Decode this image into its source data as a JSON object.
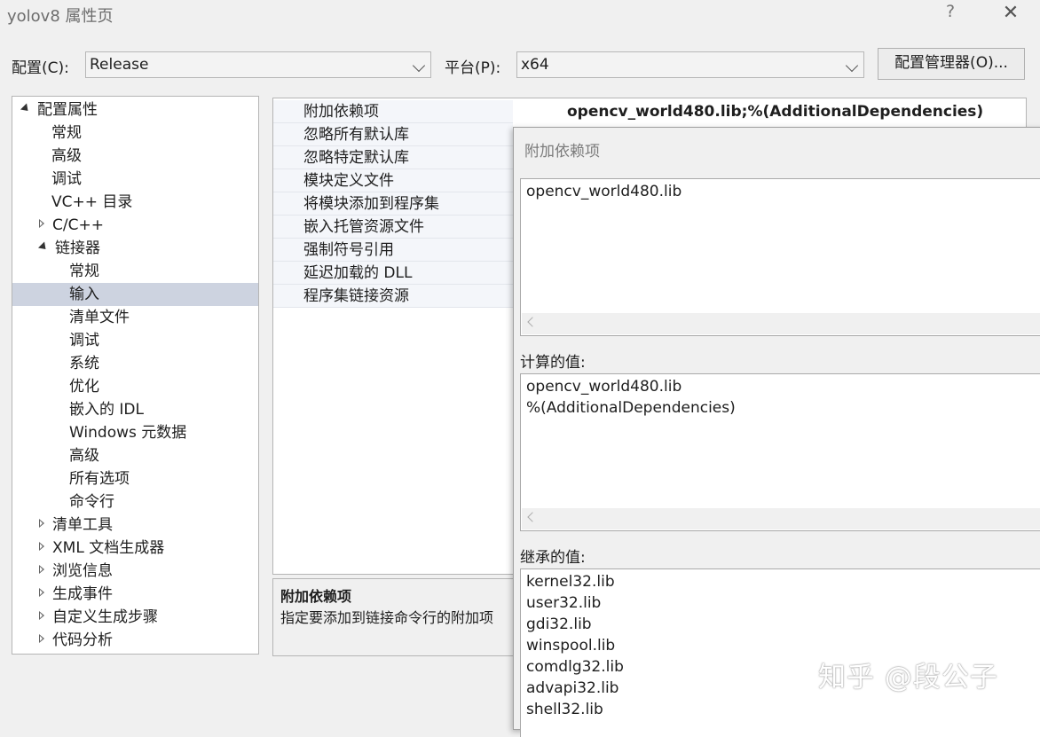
{
  "window": {
    "title": "yolov8 属性页",
    "help_label": "?",
    "close_label": "✕"
  },
  "config_row": {
    "config_label": "配置(C):",
    "config_value": "Release",
    "platform_label": "平台(P):",
    "platform_value": "x64",
    "manager_button": "配置管理器(O)..."
  },
  "tree": {
    "items": [
      {
        "label": "配置属性",
        "level": 0,
        "expander": "expanded"
      },
      {
        "label": "常规",
        "level": 1,
        "expander": "none"
      },
      {
        "label": "高级",
        "level": 1,
        "expander": "none"
      },
      {
        "label": "调试",
        "level": 1,
        "expander": "none"
      },
      {
        "label": "VC++ 目录",
        "level": 1,
        "expander": "none"
      },
      {
        "label": "C/C++",
        "level": 1,
        "expander": "collapsed"
      },
      {
        "label": "链接器",
        "level": 1,
        "expander": "expanded"
      },
      {
        "label": "常规",
        "level": 2,
        "expander": "none"
      },
      {
        "label": "输入",
        "level": 2,
        "expander": "none",
        "selected": true
      },
      {
        "label": "清单文件",
        "level": 2,
        "expander": "none"
      },
      {
        "label": "调试",
        "level": 2,
        "expander": "none"
      },
      {
        "label": "系统",
        "level": 2,
        "expander": "none"
      },
      {
        "label": "优化",
        "level": 2,
        "expander": "none"
      },
      {
        "label": "嵌入的 IDL",
        "level": 2,
        "expander": "none"
      },
      {
        "label": "Windows 元数据",
        "level": 2,
        "expander": "none"
      },
      {
        "label": "高级",
        "level": 2,
        "expander": "none"
      },
      {
        "label": "所有选项",
        "level": 2,
        "expander": "none"
      },
      {
        "label": "命令行",
        "level": 2,
        "expander": "none"
      },
      {
        "label": "清单工具",
        "level": 1,
        "expander": "collapsed"
      },
      {
        "label": "XML 文档生成器",
        "level": 1,
        "expander": "collapsed"
      },
      {
        "label": "浏览信息",
        "level": 1,
        "expander": "collapsed"
      },
      {
        "label": "生成事件",
        "level": 1,
        "expander": "collapsed"
      },
      {
        "label": "自定义生成步骤",
        "level": 1,
        "expander": "collapsed"
      },
      {
        "label": "代码分析",
        "level": 1,
        "expander": "collapsed"
      }
    ]
  },
  "properties": {
    "rows": [
      {
        "name": "附加依赖项",
        "value": "opencv_world480.lib;%(AdditionalDependencies)"
      },
      {
        "name": "忽略所有默认库",
        "value": ""
      },
      {
        "name": "忽略特定默认库",
        "value": ""
      },
      {
        "name": "模块定义文件",
        "value": ""
      },
      {
        "name": "将模块添加到程序集",
        "value": ""
      },
      {
        "name": "嵌入托管资源文件",
        "value": ""
      },
      {
        "name": "强制符号引用",
        "value": ""
      },
      {
        "name": "延迟加载的 DLL",
        "value": ""
      },
      {
        "name": "程序集链接资源",
        "value": ""
      }
    ]
  },
  "description": {
    "title": "附加依赖项",
    "text": "指定要添加到链接命令行的附加项"
  },
  "popup": {
    "title": "附加依赖项",
    "edit_lines": [
      "opencv_world480.lib"
    ],
    "computed_label": "计算的值:",
    "computed_lines": [
      "opencv_world480.lib",
      "%(AdditionalDependencies)"
    ],
    "inherited_label": "继承的值:",
    "inherited_lines": [
      "kernel32.lib",
      "user32.lib",
      "gdi32.lib",
      "winspool.lib",
      "comdlg32.lib",
      "advapi32.lib",
      "shell32.lib"
    ]
  },
  "watermark": "知乎 @段公子"
}
